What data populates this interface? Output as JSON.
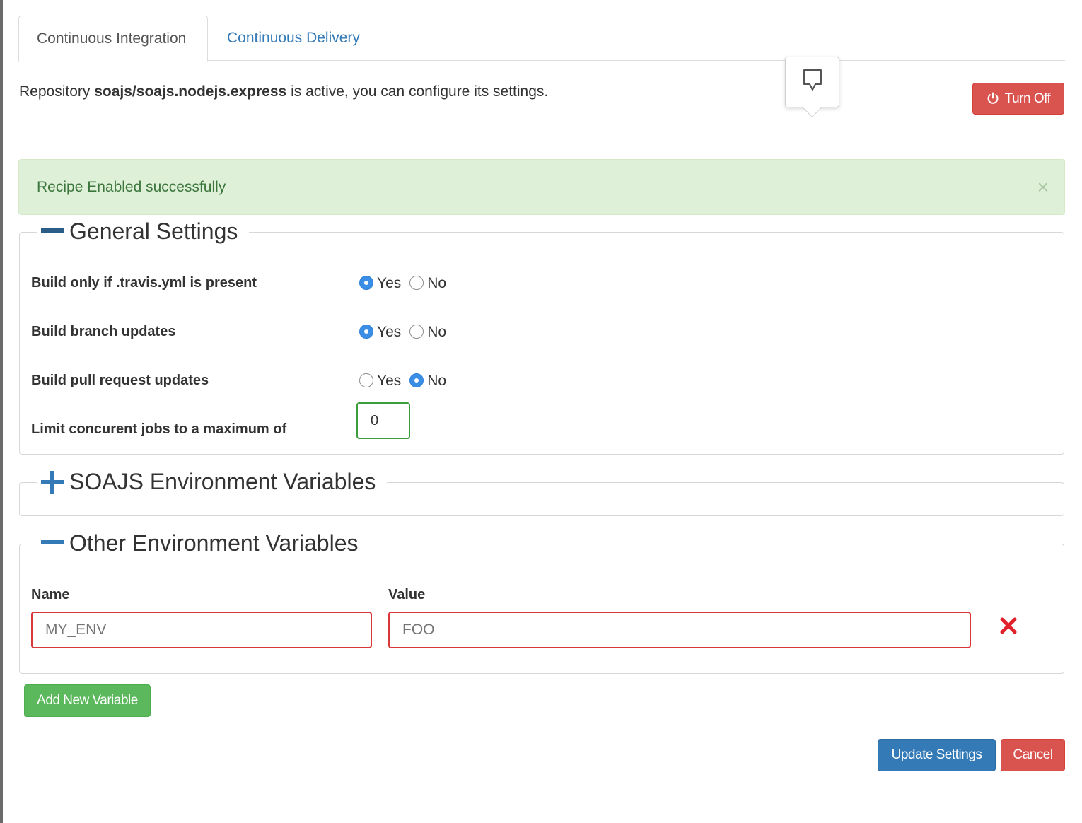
{
  "tabs": [
    {
      "label": "Continuous Integration",
      "active": true
    },
    {
      "label": "Continuous Delivery",
      "active": false
    }
  ],
  "repo": {
    "prefix": "Repository",
    "name": "soajs/soajs.nodejs.express",
    "suffix": "is active, you can configure its settings."
  },
  "turn_off_label": "Turn Off",
  "alert": {
    "message": "Recipe Enabled successfully",
    "close": "×"
  },
  "general_settings": {
    "title": "General Settings",
    "rows": [
      {
        "label": "Build only if .travis.yml is present",
        "yes": "Yes",
        "no": "No",
        "selected": "Yes"
      },
      {
        "label": "Build branch updates",
        "yes": "Yes",
        "no": "No",
        "selected": "Yes"
      },
      {
        "label": "Build pull request updates",
        "yes": "Yes",
        "no": "No",
        "selected": "No"
      }
    ],
    "limit_label": "Limit concurent jobs to a maximum of",
    "limit_value": "0"
  },
  "soajs_env": {
    "title": "SOAJS Environment Variables"
  },
  "other_env": {
    "title": "Other Environment Variables",
    "name_label": "Name",
    "value_label": "Value",
    "name_placeholder": "MY_ENV",
    "value_placeholder": "FOO"
  },
  "add_variable_label": "Add New Variable",
  "update_label": "Update Settings",
  "cancel_label": "Cancel",
  "colors": {
    "primary": "#337ab7",
    "danger": "#d9534f",
    "success": "#5cb85c",
    "alert_bg": "#dff0d8",
    "alert_text": "#3c763d"
  }
}
